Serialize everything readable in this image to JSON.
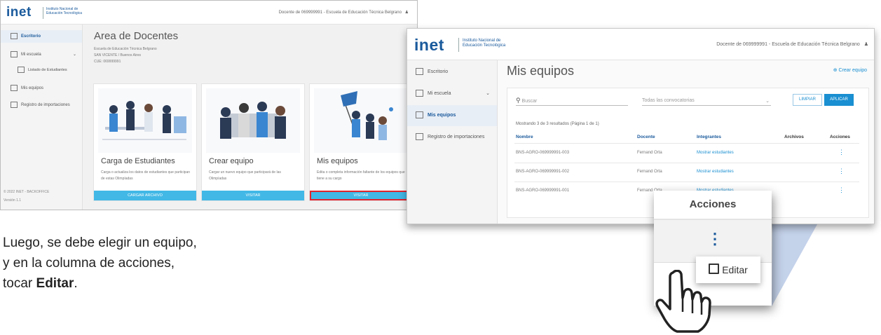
{
  "screen1": {
    "logo": "inet",
    "logo_sub": "Instituto Nacional de Educación Tecnológica",
    "user": "Docente de 069999991 - Escuela de Educación Técnica Belgrano",
    "user_icon": "user-icon",
    "nav": [
      {
        "label": "Escritorio",
        "icon": "home-icon"
      },
      {
        "label": "Mi escuela",
        "icon": "school-icon"
      },
      {
        "label": "Listado de Estudiantes",
        "icon": "students-icon"
      },
      {
        "label": "Mis equipos",
        "icon": "teams-icon"
      },
      {
        "label": "Registro de importaciones",
        "icon": "import-icon"
      }
    ],
    "footer": "© 2022 INET - BACKOFFICE",
    "version": "Versión 1.1",
    "title": "Area de Docentes",
    "info": [
      "Escuela de Educación Técnica Belgrano",
      "SAN VICENTE / Buenos Aires",
      "CUE: 069999991"
    ],
    "cards": [
      {
        "title": "Carga de Estudiantes",
        "desc": "Carga o actualiza los datos de estudiantes que participan de estas Olimpíadas",
        "button": "CARGAR ARCHIVO"
      },
      {
        "title": "Crear equipo",
        "desc": "Cargar un nuevo equipo que participará de las Olimpíadas",
        "button": "VISITAR"
      },
      {
        "title": "Mis equipos",
        "desc": "Edita o completa información faltante de los equipos que tiene a su cargo",
        "button": "VISITAR"
      }
    ]
  },
  "screen2": {
    "logo": "inet",
    "logo_sub": "Instituto Nacional de Educación Tecnológica",
    "user": "Docente de 069999991 - Escuela de Educación Técnica Belgrano",
    "nav": [
      {
        "label": "Escritorio"
      },
      {
        "label": "Mi escuela"
      },
      {
        "label": "Mis equipos"
      },
      {
        "label": "Registro de importaciones"
      }
    ],
    "title": "Mis equipos",
    "create": "Crear equipo",
    "search_placeholder": "Buscar",
    "select_value": "Todas las convocatorias",
    "btn_clear": "LIMPIAR",
    "btn_apply": "APLICAR",
    "results": "Mostrando 3 de 3 resultados (Página 1 de 1)",
    "columns": [
      "Nombre",
      "Docente",
      "Integrantes",
      "Archivos",
      "Acciones"
    ],
    "rows": [
      {
        "name": "BNS-AGRO-069999991-003",
        "teacher": "Fernand Orta",
        "members": "Mostrar estudiantes"
      },
      {
        "name": "BNS-AGRO-069999991-002",
        "teacher": "Fernand Orta",
        "members": "Mostrar estudiantes"
      },
      {
        "name": "BNS-AGRO-069999991-001",
        "teacher": "Fernand Orta",
        "members": "Mostrar estudiantes"
      }
    ],
    "actions_icon": "⋮"
  },
  "zoom": {
    "header": "Acciones",
    "dots": "⋮",
    "edit_label": "Editar",
    "edit_icon": "edit-icon"
  },
  "caption": {
    "line1": "Luego, se debe elegir un equipo,",
    "line2": "y en la columna de acciones,",
    "line3_pre": "tocar ",
    "line3_bold": "Editar",
    "line3_post": "."
  },
  "colors": {
    "brand": "#1a5a9c",
    "accent": "#42b8e6",
    "highlight": "#e0262f"
  }
}
